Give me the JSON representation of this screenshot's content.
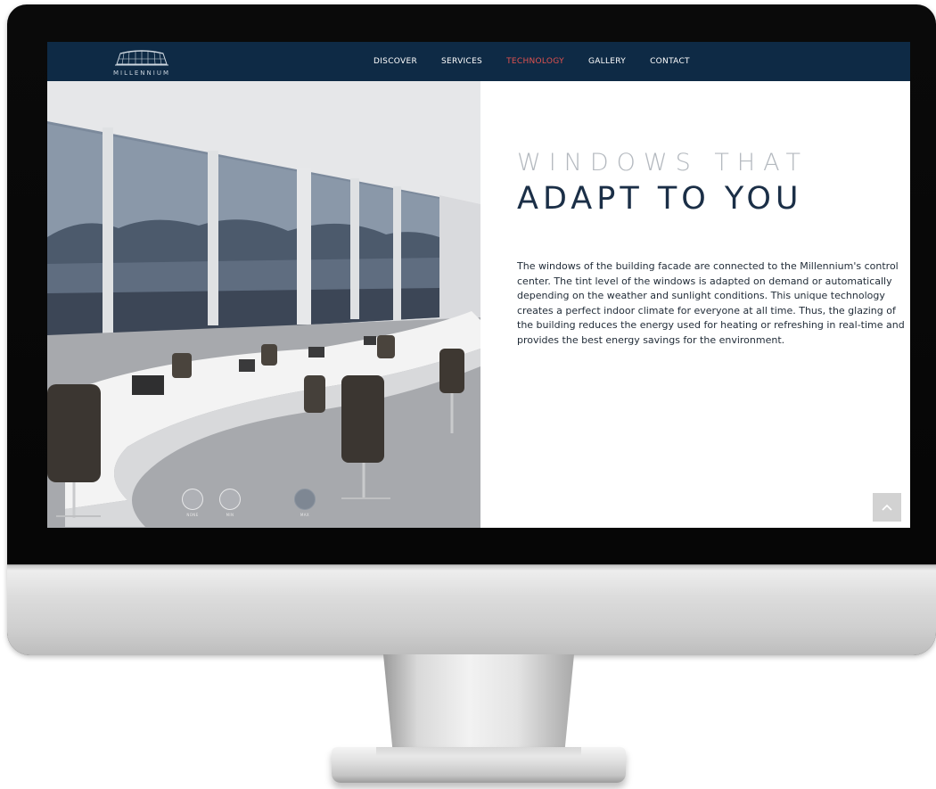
{
  "brand": {
    "name": "MILLENNIUM"
  },
  "nav": {
    "items": [
      {
        "label": "DISCOVER"
      },
      {
        "label": "SERVICES"
      },
      {
        "label": "TECHNOLOGY"
      },
      {
        "label": "GALLERY"
      },
      {
        "label": "CONTACT"
      }
    ],
    "active_index": 2
  },
  "hero": {
    "tint_options": [
      {
        "label": "NONE"
      },
      {
        "label": "MIN"
      },
      {
        "label": "MAX"
      }
    ],
    "selected_tint": "MAX"
  },
  "content": {
    "title_line1": "WINDOWS THAT",
    "title_line2": "ADAPT TO YOU",
    "body": "The windows of the building facade are connected to the Millennium's control center. The tint level of the windows is adapted on demand or automatically depending on the weather and sunlight conditions. This unique technology creates a perfect indoor climate for everyone at all time. Thus, the glazing of the building reduces the energy used for heating or refreshing in real-time and provides the best energy savings for the environment."
  },
  "colors": {
    "nav_bg": "#0e2a45",
    "accent": "#e0524f",
    "title_light": "#b4b9bf",
    "title_dark": "#1b2f47"
  },
  "icons": {
    "scroll_top": "chevron-up-icon",
    "logo": "stadium-logo-icon"
  }
}
